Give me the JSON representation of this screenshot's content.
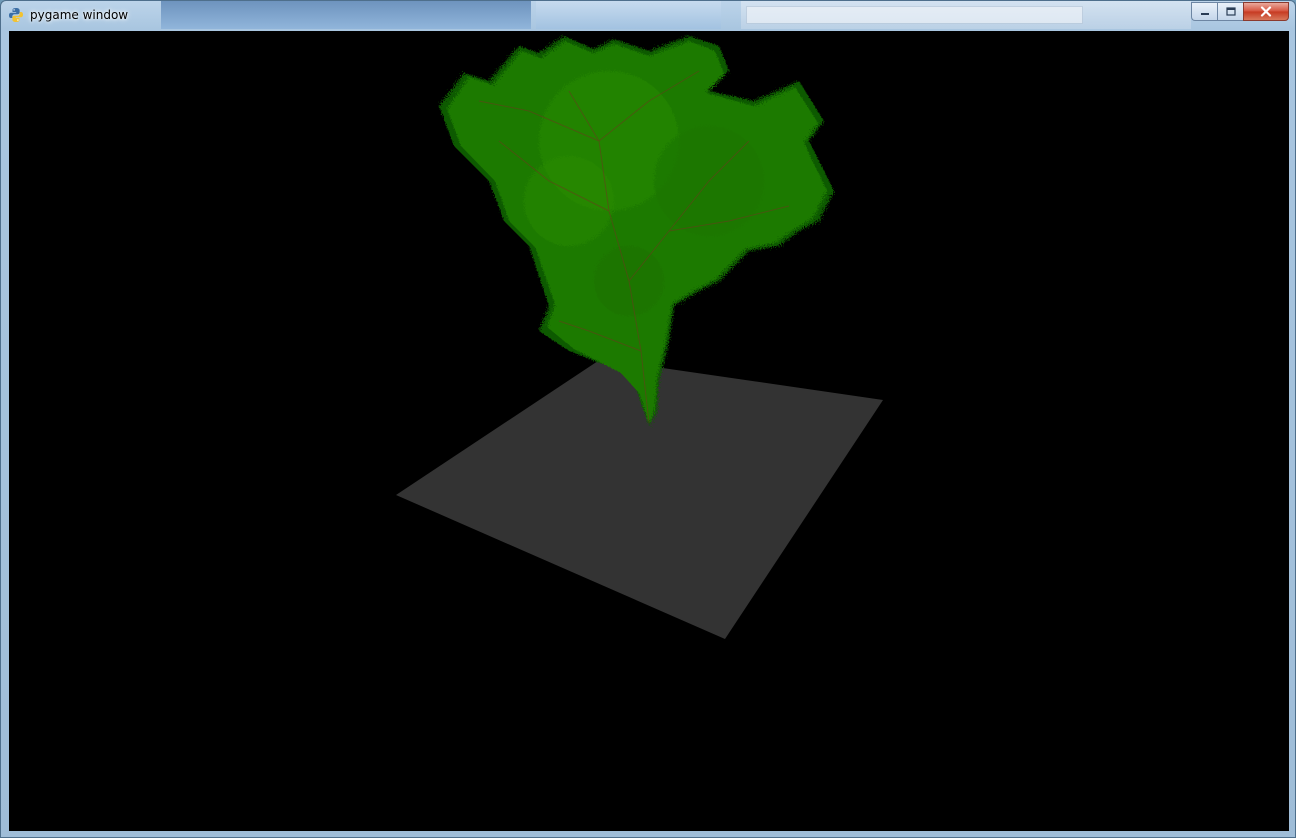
{
  "window": {
    "title": "pygame window",
    "app_icon": "python-snake-icon",
    "buttons": [
      {
        "name": "minimize-button",
        "icon": "minimize-icon"
      },
      {
        "name": "maximize-button",
        "icon": "maximize-icon"
      },
      {
        "name": "close-button",
        "icon": "close-icon"
      }
    ]
  },
  "scene": {
    "background_color": "#000000",
    "ground_color": "#333333",
    "tree_color": "#1f7a00",
    "tree_shade_color": "#0f5a00",
    "branch_color": "#6b3a1e"
  }
}
